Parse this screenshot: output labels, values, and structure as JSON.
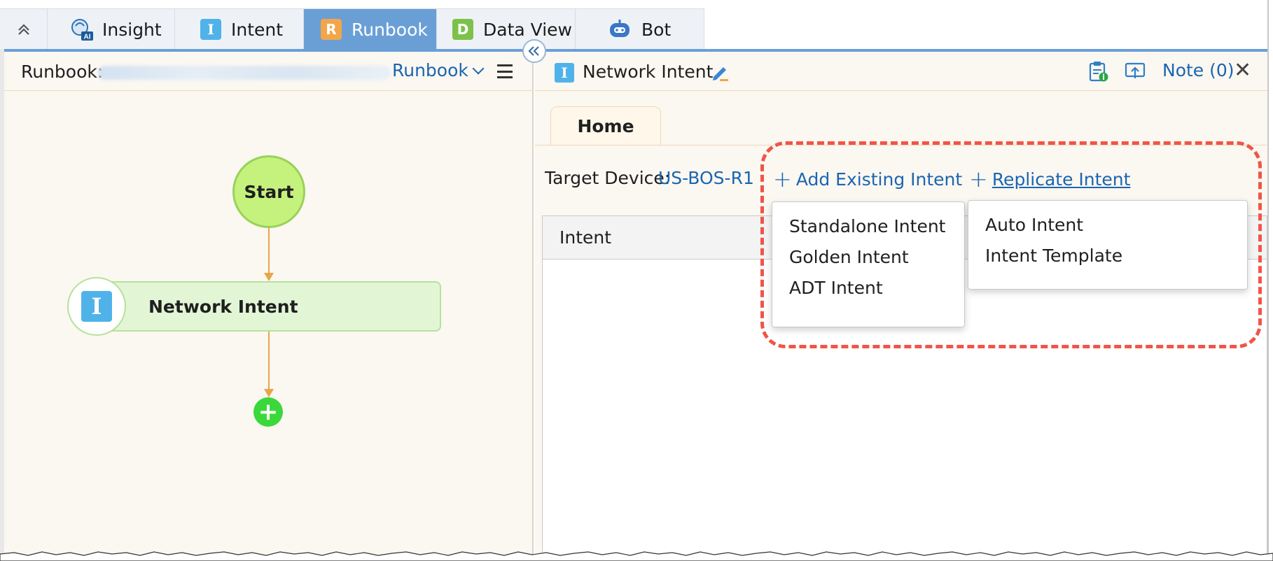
{
  "tabs": [
    {
      "label": "Insight",
      "icon": "ai-brain-icon"
    },
    {
      "label": "Intent",
      "icon": "intent-i-icon"
    },
    {
      "label": "Runbook",
      "icon": "runbook-r-icon",
      "active": true
    },
    {
      "label": "Data View",
      "icon": "data-view-d-icon"
    },
    {
      "label": "Bot",
      "icon": "bot-icon"
    }
  ],
  "left": {
    "runbook_label": "Runbook:",
    "runbook_dropdown": "Runbook",
    "start_node": "Start",
    "intent_node": "Network Intent"
  },
  "right": {
    "title": "Network Intent",
    "note": "Note (0)",
    "home_tab": "Home",
    "target_label": "Target Device:",
    "target_value": "US-BOS-R1",
    "add_existing": "Add Existing Intent",
    "replicate": "Replicate Intent",
    "table_header": "Intent",
    "add_existing_menu": [
      "Standalone Intent",
      "Golden Intent",
      "ADT Intent"
    ],
    "replicate_menu": [
      "Auto Intent",
      "Intent Template"
    ]
  },
  "colors": {
    "accent": "#1a66b0",
    "active_tab": "#6a9fd6",
    "start_fill": "#c5f27d",
    "intent_fill": "#e2f6d6",
    "highlight": "#f05548",
    "add_node": "#3bd83b"
  }
}
